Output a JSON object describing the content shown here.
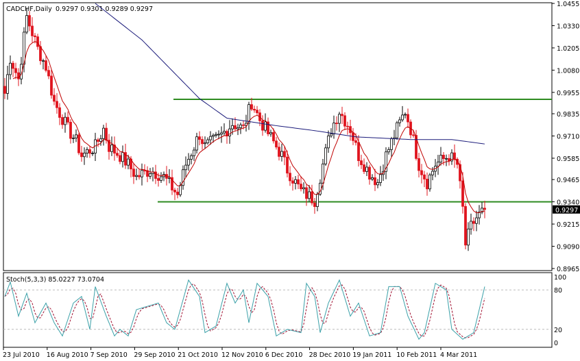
{
  "header": {
    "symbol": "CADCHF,Daily",
    "ohlc": "0.9297 0.9301 0.9289 0.9297"
  },
  "indicator": {
    "label": "Stoch(5,3,3) 85.0227 73.0704"
  },
  "colors": {
    "bull": "#000000",
    "bear": "#e0141e",
    "ma_fast": "#c00000",
    "ma_slow": "#1a1a7a",
    "levels": "#2e8b20",
    "stoch_k": "#3aa0a8",
    "stoch_d": "#a01030"
  },
  "chart_data": [
    {
      "type": "candlestick",
      "title": "CADCHF, Daily",
      "ylim": [
        0.8965,
        1.0455
      ],
      "y_ticks": [
        "1.0455",
        "1.0330",
        "1.0205",
        "1.0080",
        "0.9955",
        "0.9835",
        "0.9710",
        "0.9585",
        "0.9465",
        "0.9340",
        "0.9215",
        "0.9090",
        "0.8965"
      ],
      "current_price": "0.9297",
      "x_ticks": [
        "23 Jul 2010",
        "16 Aug 2010",
        "7 Sep 2010",
        "29 Sep 2010",
        "21 Oct 2010",
        "12 Nov 2010",
        "6 Dec 2010",
        "28 Dec 2010",
        "19 Jan 2011",
        "10 Feb 2011",
        "4 Mar 2011"
      ],
      "bars_total": 176,
      "close_keypoints": [
        [
          0,
          0.995
        ],
        [
          2,
          1.015
        ],
        [
          5,
          1.003
        ],
        [
          8,
          1.038
        ],
        [
          12,
          1.02
        ],
        [
          15,
          1.01
        ],
        [
          18,
          0.99
        ],
        [
          23,
          0.975
        ],
        [
          26,
          0.968
        ],
        [
          28,
          0.96
        ],
        [
          33,
          0.965
        ],
        [
          36,
          0.975
        ],
        [
          38,
          0.965
        ],
        [
          42,
          0.96
        ],
        [
          45,
          0.955
        ],
        [
          48,
          0.948
        ],
        [
          53,
          0.952
        ],
        [
          58,
          0.948
        ],
        [
          63,
          0.938
        ],
        [
          66,
          0.955
        ],
        [
          71,
          0.972
        ],
        [
          73,
          0.965
        ],
        [
          78,
          0.97
        ],
        [
          83,
          0.978
        ],
        [
          87,
          0.975
        ],
        [
          90,
          0.99
        ],
        [
          93,
          0.98
        ],
        [
          97,
          0.97
        ],
        [
          101,
          0.96
        ],
        [
          103,
          0.952
        ],
        [
          108,
          0.94
        ],
        [
          113,
          0.935
        ],
        [
          116,
          0.955
        ],
        [
          119,
          0.975
        ],
        [
          122,
          0.985
        ],
        [
          126,
          0.975
        ],
        [
          129,
          0.96
        ],
        [
          133,
          0.95
        ],
        [
          136,
          0.945
        ],
        [
          139,
          0.96
        ],
        [
          143,
          0.975
        ],
        [
          146,
          0.985
        ],
        [
          148,
          0.975
        ],
        [
          151,
          0.955
        ],
        [
          154,
          0.945
        ],
        [
          157,
          0.955
        ],
        [
          162,
          0.96
        ],
        [
          165,
          0.955
        ],
        [
          167,
          0.93
        ],
        [
          168,
          0.91
        ],
        [
          170,
          0.92
        ],
        [
          172,
          0.925
        ],
        [
          175,
          0.9297
        ]
      ],
      "ma_slow_keypoints": [
        [
          33,
          1.0455
        ],
        [
          50,
          1.025
        ],
        [
          71,
          0.992
        ],
        [
          81,
          0.981
        ],
        [
          98,
          0.977
        ],
        [
          113,
          0.974
        ],
        [
          128,
          0.9705
        ],
        [
          148,
          0.969
        ],
        [
          163,
          0.969
        ],
        [
          175,
          0.9665
        ]
      ],
      "horizontal_levels": [
        0.9916,
        0.934
      ]
    },
    {
      "type": "line",
      "title": "Stoch(5,3,3)",
      "ylim": [
        0,
        100
      ],
      "y_ticks": [
        "100",
        "80",
        "20",
        "0"
      ],
      "levels": [
        80,
        20
      ],
      "k_keypoints": [
        [
          0,
          70
        ],
        [
          2,
          92
        ],
        [
          5,
          40
        ],
        [
          8,
          75
        ],
        [
          11,
          30
        ],
        [
          15,
          60
        ],
        [
          18,
          30
        ],
        [
          21,
          10
        ],
        [
          25,
          60
        ],
        [
          28,
          70
        ],
        [
          31,
          20
        ],
        [
          33,
          85
        ],
        [
          37,
          40
        ],
        [
          40,
          10
        ],
        [
          42,
          20
        ],
        [
          45,
          10
        ],
        [
          48,
          50
        ],
        [
          56,
          60
        ],
        [
          59,
          30
        ],
        [
          62,
          20
        ],
        [
          67,
          95
        ],
        [
          71,
          70
        ],
        [
          73,
          15
        ],
        [
          77,
          25
        ],
        [
          81,
          90
        ],
        [
          84,
          60
        ],
        [
          87,
          80
        ],
        [
          89,
          30
        ],
        [
          92,
          90
        ],
        [
          96,
          70
        ],
        [
          99,
          10
        ],
        [
          103,
          20
        ],
        [
          108,
          15
        ],
        [
          110,
          90
        ],
        [
          113,
          70
        ],
        [
          115,
          15
        ],
        [
          118,
          60
        ],
        [
          122,
          95
        ],
        [
          126,
          40
        ],
        [
          129,
          60
        ],
        [
          133,
          10
        ],
        [
          137,
          15
        ],
        [
          140,
          85
        ],
        [
          144,
          85
        ],
        [
          147,
          40
        ],
        [
          151,
          5
        ],
        [
          153,
          15
        ],
        [
          157,
          90
        ],
        [
          161,
          80
        ],
        [
          163,
          20
        ],
        [
          167,
          5
        ],
        [
          171,
          15
        ],
        [
          175,
          85
        ]
      ]
    }
  ]
}
